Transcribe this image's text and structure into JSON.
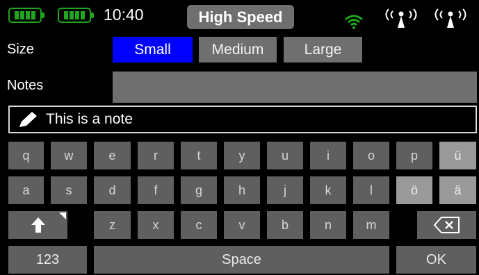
{
  "status": {
    "time": "10:40",
    "mode": "High Speed",
    "colors": {
      "battery": "#1fa51f",
      "wifi": "#1fa51f",
      "antenna": "#ffffff"
    }
  },
  "size_row": {
    "label": "Size",
    "options": [
      "Small",
      "Medium",
      "Large"
    ],
    "selected": "Small"
  },
  "notes_row": {
    "label": "Notes",
    "value": ""
  },
  "note_input": {
    "value": "This is a note"
  },
  "keyboard": {
    "row1": [
      "q",
      "w",
      "e",
      "r",
      "t",
      "y",
      "u",
      "i",
      "o",
      "p",
      "ü"
    ],
    "row2": [
      "a",
      "s",
      "d",
      "f",
      "g",
      "h",
      "j",
      "k",
      "l",
      "ö",
      "ä"
    ],
    "row3": [
      "z",
      "x",
      "c",
      "v",
      "b",
      "n",
      "m"
    ],
    "bottom": {
      "numbers": "123",
      "space": "Space",
      "ok": "OK"
    }
  }
}
